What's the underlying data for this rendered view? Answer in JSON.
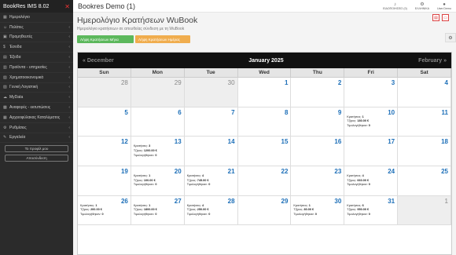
{
  "app": {
    "name": "BookRes IMS 8.02",
    "close_symbol": "✕"
  },
  "sidebar": {
    "items": [
      {
        "label": "Ημερολόγιο",
        "icon": "calendar-icon",
        "glyph": "▦",
        "chevron": false
      },
      {
        "label": "Πελάτες",
        "icon": "users-icon",
        "glyph": "☺",
        "chevron": true
      },
      {
        "label": "Προμηθευτές",
        "icon": "truck-icon",
        "glyph": "▣",
        "chevron": true
      },
      {
        "label": "Έσοδα",
        "icon": "dollar-icon",
        "glyph": "$",
        "chevron": true
      },
      {
        "label": "Έξοδα",
        "icon": "wallet-icon",
        "glyph": "▤",
        "chevron": true
      },
      {
        "label": "Προϊόντα - υπηρεσίες",
        "icon": "box-icon",
        "glyph": "▥",
        "chevron": true
      },
      {
        "label": "Χρηματοοικονομικά",
        "icon": "bank-icon",
        "glyph": "▧",
        "chevron": true
      },
      {
        "label": "Γενική Λογιστική",
        "icon": "ledger-icon",
        "glyph": "▨",
        "chevron": true
      },
      {
        "label": "MyData",
        "icon": "cloud-icon",
        "glyph": "☁",
        "chevron": true
      },
      {
        "label": "Αναφορές - εκτυπώσεις",
        "icon": "chart-icon",
        "glyph": "▩",
        "chevron": true
      },
      {
        "label": "Αρχειοφύλακας Καταλύματος",
        "icon": "archive-icon",
        "glyph": "▦",
        "chevron": true
      },
      {
        "label": "Ρυθμίσεις",
        "icon": "gear-icon",
        "glyph": "⚙",
        "chevron": true
      },
      {
        "label": "Εργαλεία",
        "icon": "tools-icon",
        "glyph": "✎",
        "chevron": true
      }
    ],
    "profile_button": "Το προφίλ μου",
    "logout_button": "Αποσύνδεση"
  },
  "topbar": {
    "title": "Bookres Demo (1)",
    "notifications": "ΕΙΔΟΠΟΙΗΣΕΙΣ (0)",
    "language": "ΕΛΛΗΝΙΚΑ",
    "user": "User.Demo"
  },
  "page": {
    "heading": "Ημερολόγιο Κρατήσεων WuBook",
    "subtitle": "Ημερολόγιο κρατήσεων σε απευθείας σύνδεση με τη WuBook",
    "btn_month": "Λήψη Κρατήσεων Μήνα",
    "btn_day": "Λήψη Κρατήσεων Ημέρας"
  },
  "calendar": {
    "month": "January 2025",
    "prev": "December",
    "next": "February",
    "days": [
      "Sun",
      "Mon",
      "Tue",
      "Wed",
      "Thu",
      "Fri",
      "Sat"
    ],
    "labels": {
      "bookings": "Κρατήσεις:",
      "nights": "Τζίρος:",
      "cancelled": "Τιμολογήθηκαν:"
    },
    "cells": [
      {
        "n": "28",
        "other": true
      },
      {
        "n": "29",
        "other": true
      },
      {
        "n": "30",
        "other": true
      },
      {
        "n": "1"
      },
      {
        "n": "2"
      },
      {
        "n": "3"
      },
      {
        "n": "4"
      },
      {
        "n": "5"
      },
      {
        "n": "6"
      },
      {
        "n": "7"
      },
      {
        "n": "8"
      },
      {
        "n": "9"
      },
      {
        "n": "10",
        "info": [
          "1",
          "180.00 €",
          "0"
        ]
      },
      {
        "n": "11"
      },
      {
        "n": "12"
      },
      {
        "n": "13",
        "info": [
          "3",
          "1200.00 €",
          "0"
        ]
      },
      {
        "n": "14"
      },
      {
        "n": "15"
      },
      {
        "n": "16"
      },
      {
        "n": "17"
      },
      {
        "n": "18"
      },
      {
        "n": "19"
      },
      {
        "n": "20",
        "info": [
          "1",
          "100.00 €",
          "0"
        ]
      },
      {
        "n": "21",
        "info": [
          "4",
          "745.00 €",
          "0"
        ]
      },
      {
        "n": "22"
      },
      {
        "n": "23"
      },
      {
        "n": "24",
        "info": [
          "4",
          "660.00 €",
          "0"
        ]
      },
      {
        "n": "25"
      },
      {
        "n": "26",
        "info": [
          "1",
          "200.00 €",
          "0"
        ]
      },
      {
        "n": "27",
        "info": [
          "1",
          "1800.00 €",
          "0"
        ]
      },
      {
        "n": "28",
        "info": [
          "4",
          "250.00 €",
          "0"
        ]
      },
      {
        "n": "29"
      },
      {
        "n": "30",
        "info": [
          "1",
          "80.00 €",
          "0"
        ]
      },
      {
        "n": "31",
        "info": [
          "6",
          "950.00 €",
          "0"
        ]
      },
      {
        "n": "1",
        "other": true
      }
    ]
  }
}
